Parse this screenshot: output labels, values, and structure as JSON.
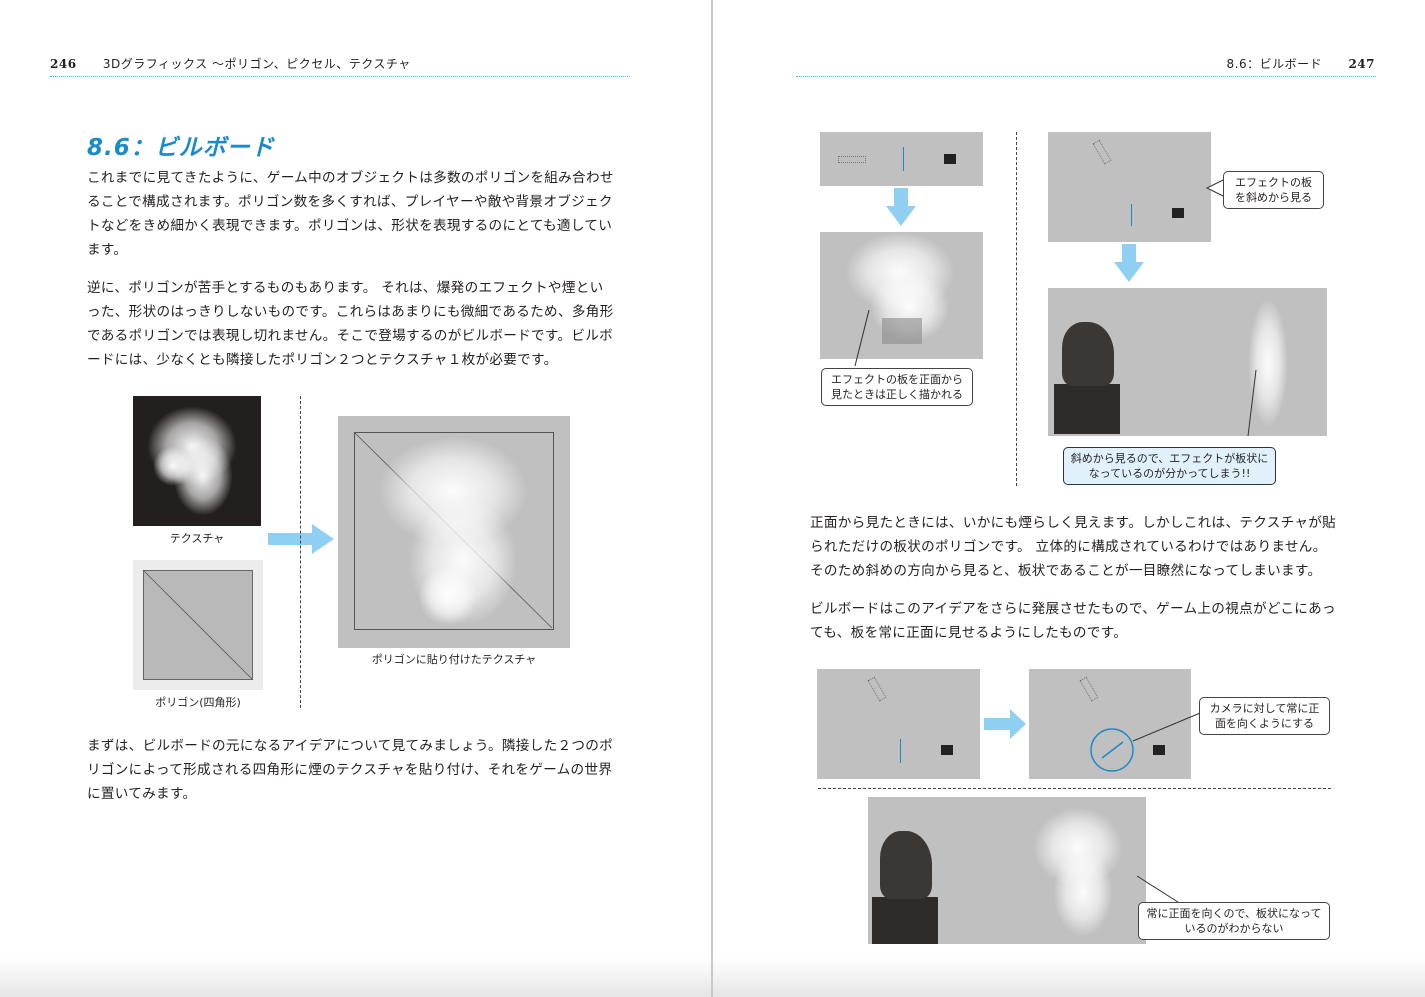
{
  "left_page": {
    "page_number": "246",
    "running_head": "3Dグラフィックス 〜ポリゴン、ピクセル、テクスチャ",
    "section_title": "8.6：ビルボード",
    "paragraphs": [
      "これまでに見てきたように、ゲーム中のオブジェクトは多数のポリゴンを組み合わせることで構成されます。ポリゴン数を多くすれば、プレイヤーや敵や背景オブジェクトなどをきめ細かく表現できます。ポリゴンは、形状を表現するのにとても適しています。",
      "逆に、ポリゴンが苦手とするものもあります。 それは、爆発のエフェクトや煙といった、形状のはっきりしないものです。これらはあまりにも微細であるため、多角形であるポリゴンでは表現し切れません。そこで登場するのがビルボードです。ビルボードには、少なくとも隣接したポリゴン２つとテクスチャ１枚が必要です。",
      "まずは、ビルボードの元になるアイデアについて見てみましょう。隣接した２つのポリゴンによって形成される四角形に煙のテクスチャを貼り付け、それをゲームの世界に置いてみます。"
    ],
    "figure": {
      "texture_caption": "テクスチャ",
      "polygon_caption": "ポリゴン(四角形)",
      "result_caption": "ポリゴンに貼り付けたテクスチャ"
    }
  },
  "right_page": {
    "page_number": "247",
    "running_head": "8.6：ビルボード",
    "callouts": {
      "front_view": "エフェクトの板を正面から見たときは正しく描かれる",
      "oblique_view": "エフェクトの板を斜めから見る",
      "oblique_result": "斜めから見るので、エフェクトが板状になっているのが分かってしまう!!",
      "face_camera": "カメラに対して常に正面を向くようにする",
      "always_front": "常に正面を向くので、板状になっているのがわからない"
    },
    "paragraphs": [
      "正面から見たときには、いかにも煙らしく見えます。しかしこれは、テクスチャが貼られただけの板状のポリゴンです。 立体的に構成されているわけではありません。そのため斜めの方向から見ると、板状であることが一目瞭然になってしまいます。",
      "ビルボードはこのアイデアをさらに発展させたもので、ゲーム上の視点がどこにあっても、板を常に正面に見せるようにしたものです。"
    ]
  },
  "colors": {
    "accent": "#1a8ac8",
    "arrow": "#8fd0f2",
    "image_gray": "#c0c0c0"
  }
}
